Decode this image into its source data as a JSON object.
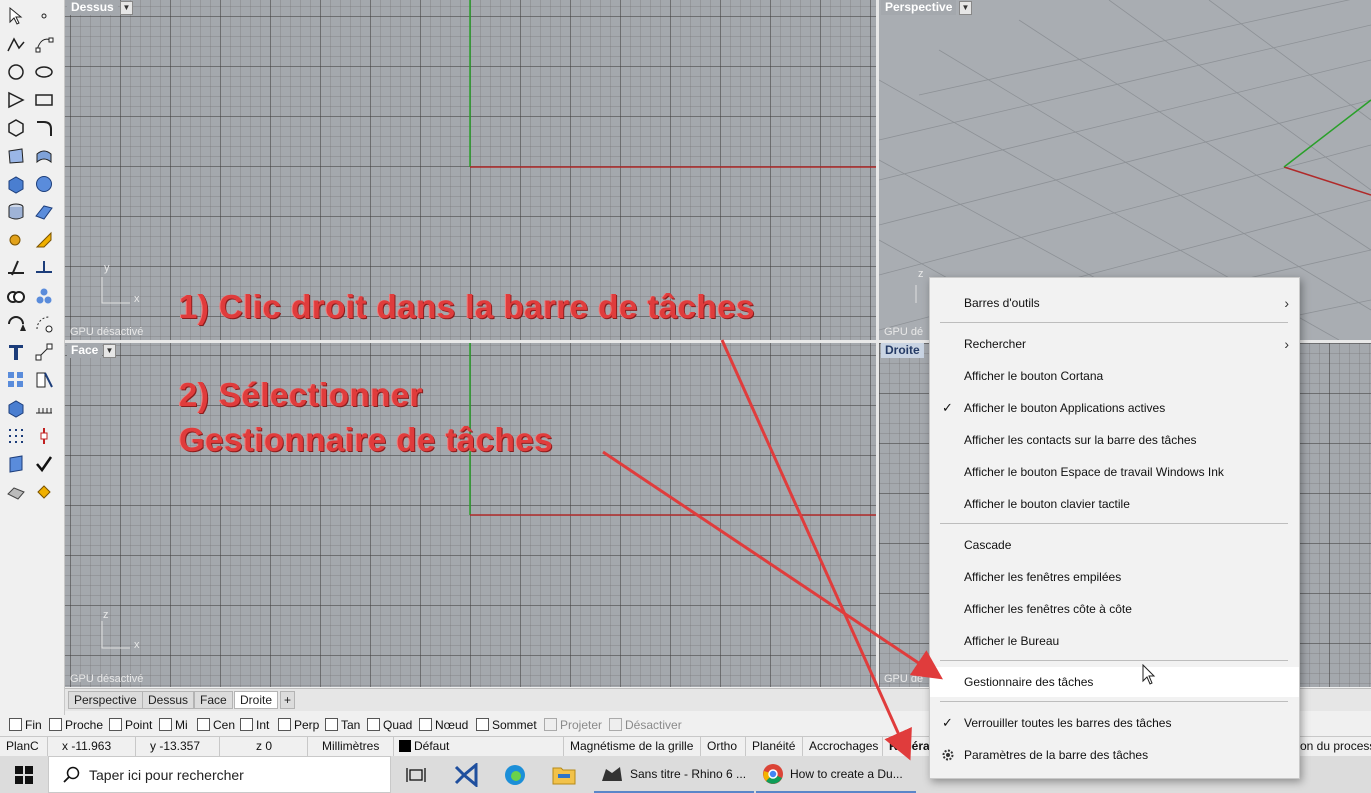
{
  "viewports": {
    "top": {
      "label": "Dessus",
      "gpu": "GPU désactivé",
      "axis_y": "y",
      "axis_x": "x"
    },
    "perspective": {
      "label": "Perspective",
      "gpu": "GPU dé",
      "axis_z": "z"
    },
    "front": {
      "label": "Face",
      "gpu": "GPU désactivé",
      "axis_z": "z",
      "axis_x": "x"
    },
    "right": {
      "label": "Droite",
      "gpu": "GPU dé"
    }
  },
  "viewport_tabs": [
    "Perspective",
    "Dessus",
    "Face",
    "Droite"
  ],
  "add_tab_symbol": "+",
  "osnaps": [
    {
      "label": "Fin"
    },
    {
      "label": "Proche"
    },
    {
      "label": "Point"
    },
    {
      "label": "Mi"
    },
    {
      "label": "Cen"
    },
    {
      "label": "Int"
    },
    {
      "label": "Perp"
    },
    {
      "label": "Tan"
    },
    {
      "label": "Quad"
    },
    {
      "label": "Nœud"
    },
    {
      "label": "Sommet"
    },
    {
      "label": "Projeter"
    },
    {
      "label": "Désactiver"
    }
  ],
  "status": {
    "cplane": "PlanC",
    "x": "x -11.963",
    "y": "y -13.357",
    "z": "z 0",
    "units": "Millimètres",
    "layer": "Défaut",
    "grid_snap": "Magnétisme de la grille",
    "ortho": "Ortho",
    "planar": "Planéité",
    "osnap": "Accrochages",
    "smarttrack": "Repérage",
    "right_fragment": "on du process"
  },
  "taskbar": {
    "search_placeholder": "Taper ici pour rechercher",
    "apps": [
      {
        "label": "Sans titre - Rhino 6 ..."
      },
      {
        "label": "How to create a Du..."
      }
    ]
  },
  "context_menu": {
    "items": [
      {
        "label": "Barres d'outils",
        "submenu": true
      },
      {
        "label": "Rechercher",
        "submenu": true
      },
      {
        "label": "Afficher le bouton Cortana"
      },
      {
        "label": "Afficher le bouton Applications actives",
        "checked": true
      },
      {
        "label": "Afficher les contacts sur la barre des tâches"
      },
      {
        "label": "Afficher le bouton Espace de travail Windows Ink"
      },
      {
        "label": "Afficher le bouton clavier tactile"
      },
      {
        "label": "Cascade"
      },
      {
        "label": "Afficher les fenêtres empilées"
      },
      {
        "label": "Afficher les fenêtres côte à côte"
      },
      {
        "label": "Afficher le Bureau"
      },
      {
        "label": "Gestionnaire des tâches",
        "highlighted": true
      },
      {
        "label": "Verrouiller toutes les barres des tâches",
        "checked": true
      },
      {
        "label": "Paramètres de la barre des tâches"
      }
    ],
    "check_glyph": "✓",
    "submenu_glyph": "›"
  },
  "annotations": {
    "step1": "1) Clic droit dans la barre de tâches",
    "step2_line1": "2) Sélectionner",
    "step2_line2": "Gestionnaire de tâches",
    "color": "#e03c3c"
  },
  "colors": {
    "viewport_bg": "#a4a8ad",
    "x_axis": "#b02a2a",
    "y_axis": "#2aa02a",
    "active_viewport_label": "#c9d4e3"
  }
}
